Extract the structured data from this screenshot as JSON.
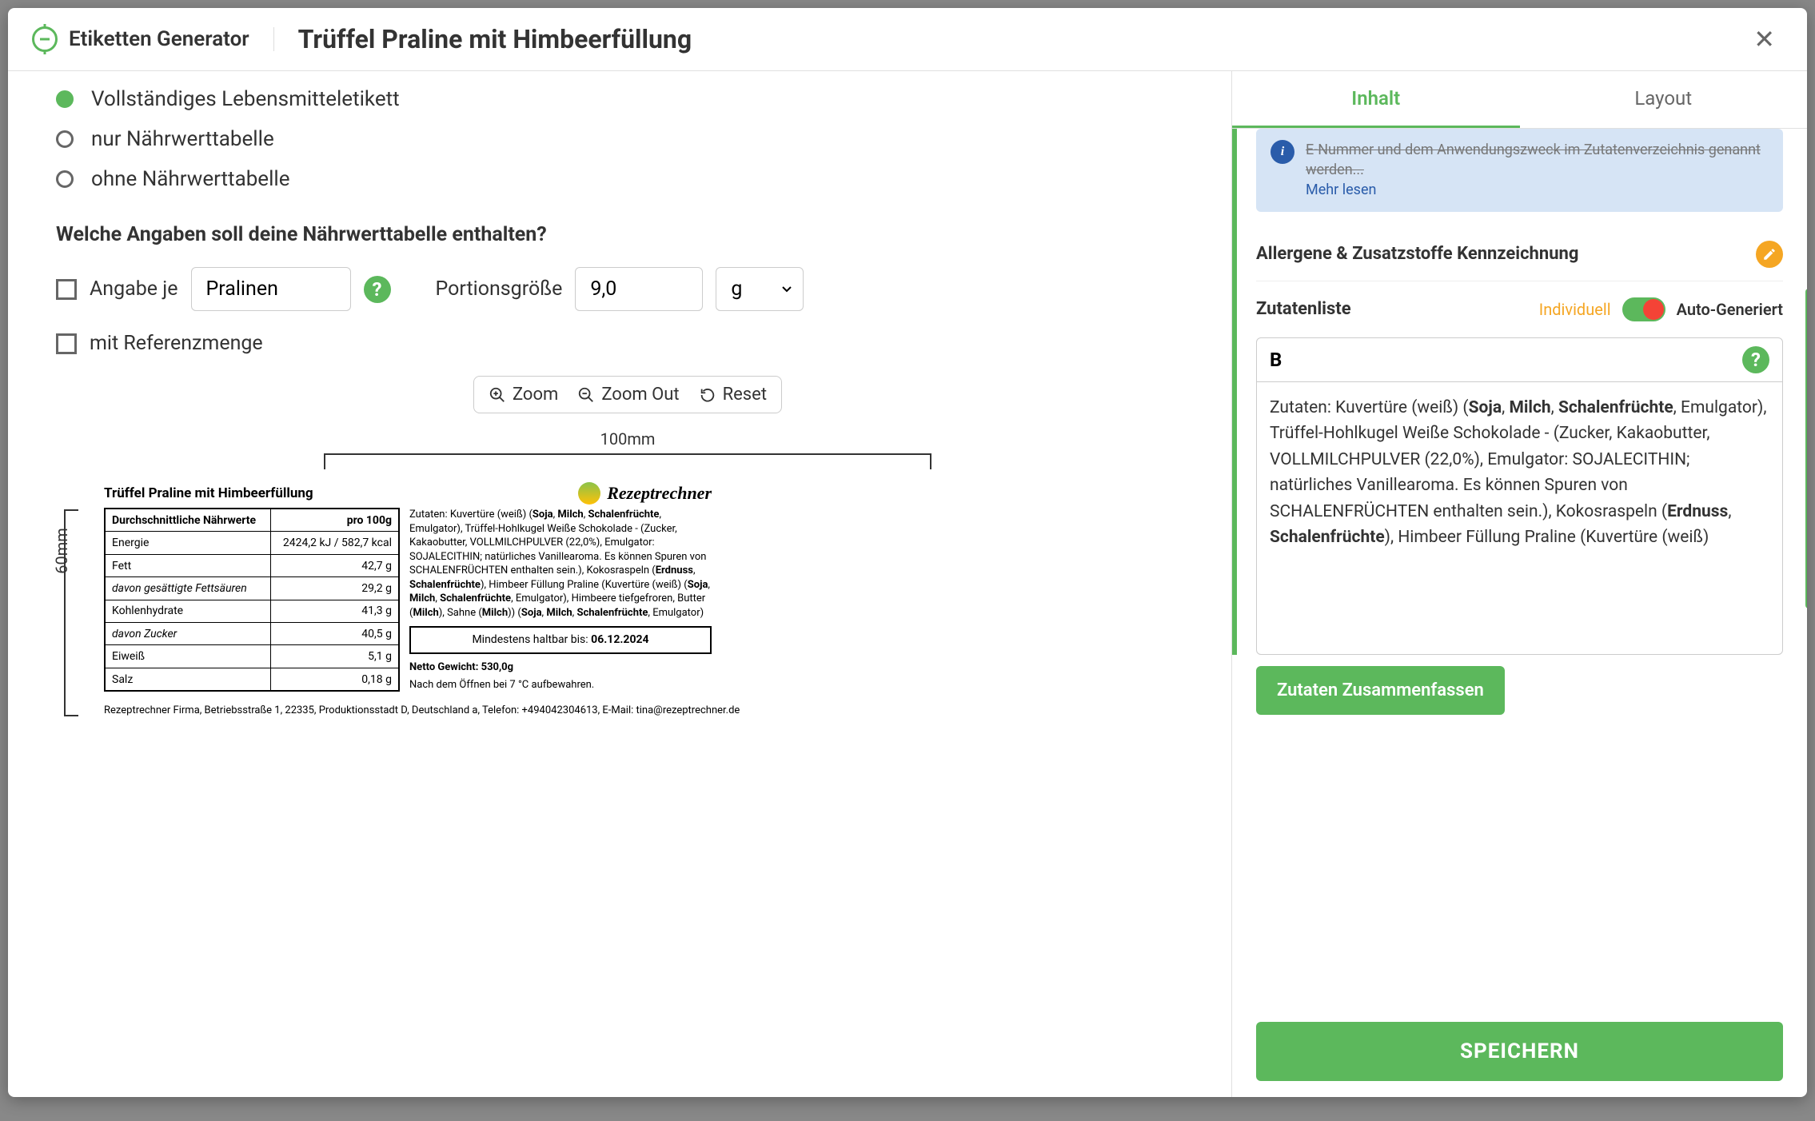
{
  "header": {
    "generator_title": "Etiketten Generator",
    "product_title": "Trüffel Praline mit Himbeerfüllung"
  },
  "label_type": {
    "options": [
      {
        "label": "Vollständiges Lebensmitteletikett",
        "selected": true
      },
      {
        "label": "nur Nährwerttabelle",
        "selected": false
      },
      {
        "label": "ohne Nährwerttabelle",
        "selected": false
      }
    ]
  },
  "nutrition_question": "Welche Angaben soll deine Nährwerttabelle enthalten?",
  "per_serving": {
    "label": "Angabe je",
    "value": "Pralinen"
  },
  "portion": {
    "label": "Portionsgröße",
    "value": "9,0",
    "unit": "g"
  },
  "reference": {
    "label": "mit Referenzmenge"
  },
  "toolbar": {
    "zoom": "Zoom",
    "zoom_out": "Zoom Out",
    "reset": "Reset"
  },
  "dimensions": {
    "width": "100mm",
    "height": "60mm"
  },
  "preview": {
    "title": "Trüffel Praline mit Himbeerfüllung",
    "brand": "Rezeptrechner",
    "nutrition": {
      "header_left": "Durchschnittliche Nährwerte",
      "header_right": "pro 100g",
      "rows": [
        {
          "name": "Energie",
          "value": "2424,2 kJ / 582,7 kcal"
        },
        {
          "name": "Fett",
          "value": "42,7 g"
        },
        {
          "name": "davon gesättigte Fettsäuren",
          "value": "29,2 g",
          "indent": true
        },
        {
          "name": "Kohlenhydrate",
          "value": "41,3 g"
        },
        {
          "name": "davon Zucker",
          "value": "40,5 g",
          "indent": true
        },
        {
          "name": "Eiweiß",
          "value": "5,1 g"
        },
        {
          "name": "Salz",
          "value": "0,18 g"
        }
      ]
    },
    "ingredients_html": "Zutaten: Kuvertüre (weiß) (<b>Soja</b>, <b>Milch</b>, <b>Schalenfrüchte</b>, Emulgator), Trüffel-Hohlkugel Weiße Schokolade - (Zucker, Kakaobutter, VOLLMILCHPULVER (22,0%), Emulgator: SOJALECITHIN; natürliches Vanillearoma. Es können Spuren von SCHALENFRÜCHTEN enthalten sein.), Kokosraspeln (<b>Erdnuss</b>, <b>Schalenfrüchte</b>), Himbeer Füllung Praline (Kuvertüre (weiß) (<b>Soja</b>, <b>Milch</b>, <b>Schalenfrüchte</b>, Emulgator), Himbeere tiefgefroren, Butter (<b>Milch</b>), Sahne (<b>Milch</b>)) (<b>Soja</b>, <b>Milch</b>, <b>Schalenfrüchte</b>, Emulgator)",
    "mhd_label": "Mindestens haltbar bis:",
    "mhd_date": "06.12.2024",
    "net_weight": "Netto Gewicht: 530,0g",
    "storage": "Nach dem Öffnen bei 7 °C aufbewahren.",
    "company": "Rezeptrechner Firma, Betriebsstraße 1, 22335, Produktionsstadt D, Deutschland a, Telefon: +494042304613, E-Mail: tina@rezeptrechner.de"
  },
  "tabs": {
    "content": "Inhalt",
    "layout": "Layout"
  },
  "info_box": {
    "text_partial": "E-Nummer und dem Anwendungszweck im Zutatenverzeichnis genannt werden...",
    "more": "Mehr lesen"
  },
  "allergen_section": "Allergene & Zusatzstoffe Kennzeichnung",
  "ingredients_panel": {
    "title": "Zutatenliste",
    "opt_individual": "Individuell",
    "opt_auto": "Auto-Generiert",
    "editor_html": "Zutaten: Kuvertüre (weiß) (<b>Soja</b>, <b>Milch</b>, <b>Schalenfrüchte</b>, Emulgator), Trüffel-Hohlkugel Weiße Schokolade - (Zucker, Kakaobutter, VOLLMILCHPULVER (22,0%), Emulgator: SOJALECITHIN; natürliches Vanillearoma. Es können Spuren von SCHALENFRÜCHTEN enthalten sein.), Kokosraspeln (<b>Erdnuss</b>, <b>Schalenfrüchte</b>), Himbeer Füllung Praline (Kuvertüre (weiß)",
    "summarize": "Zutaten Zusammenfassen"
  },
  "save": "SPEICHERN"
}
